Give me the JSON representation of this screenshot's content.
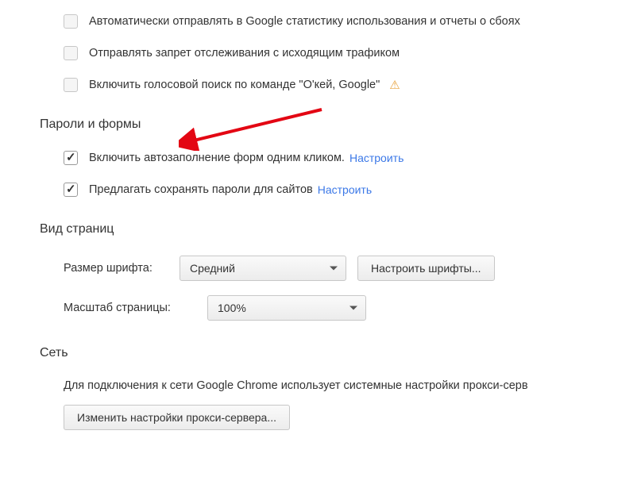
{
  "privacy": {
    "stats_label": "Автоматически отправлять в Google статистику использования и отчеты о сбоях",
    "dnt_label": "Отправлять запрет отслеживания с исходящим трафиком",
    "voice_label": "Включить голосовой поиск по команде \"О'кей, Google\""
  },
  "passwords": {
    "title": "Пароли и формы",
    "autofill_label": "Включить автозаполнение форм одним кликом.",
    "autofill_link": "Настроить",
    "save_passwords_label": "Предлагать сохранять пароли для сайтов",
    "save_passwords_link": "Настроить"
  },
  "appearance": {
    "title": "Вид страниц",
    "font_size_label": "Размер шрифта:",
    "font_size_value": "Средний",
    "customize_fonts_button": "Настроить шрифты...",
    "zoom_label": "Масштаб страницы:",
    "zoom_value": "100%"
  },
  "network": {
    "title": "Сеть",
    "description": "Для подключения к сети Google Chrome использует системные настройки прокси-серв",
    "proxy_button": "Изменить настройки прокси-сервера..."
  }
}
